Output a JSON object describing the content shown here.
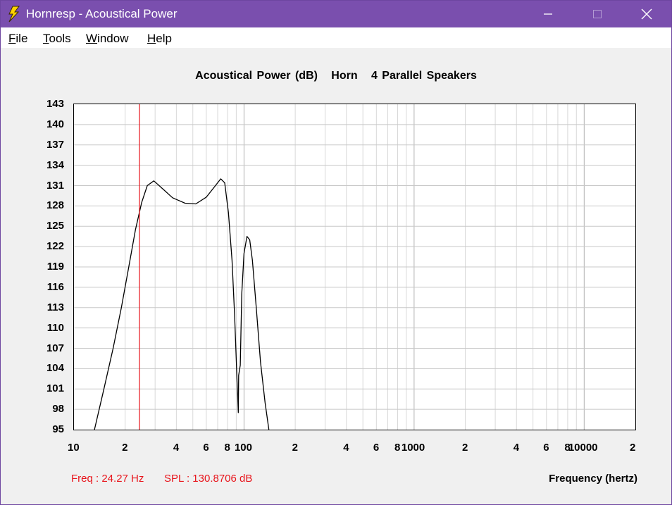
{
  "window": {
    "title": "Hornresp - Acoustical Power",
    "title_bar_color": "#7a4fae",
    "controls": [
      "minimize-icon",
      "maximize-icon",
      "close-icon"
    ]
  },
  "menu": {
    "file": {
      "label_first": "F",
      "label_rest": "ile"
    },
    "tools": {
      "label_first": "T",
      "label_rest": "ools"
    },
    "window": {
      "label_first": "W",
      "label_rest": "indow"
    },
    "help": {
      "label_first": "H",
      "label_rest": "elp"
    }
  },
  "status": {
    "freq": "Freq : 24.27 Hz",
    "spl": "SPL : 130.8706 dB",
    "color": "#e8141b"
  },
  "chart_data": {
    "type": "line",
    "title": "Acoustical Power (dB)   Horn   4 Parallel Speakers",
    "xlabel": "Frequency (hertz)",
    "ylabel": "",
    "x_scale": "log",
    "xlim": [
      10,
      20000
    ],
    "ylim": [
      95,
      143
    ],
    "yticks": [
      "143",
      "140",
      "137",
      "134",
      "131",
      "128",
      "125",
      "122",
      "119",
      "116",
      "113",
      "110",
      "107",
      "104",
      "101",
      "98",
      "95"
    ],
    "xtick_labels": [
      {
        "x": 10,
        "label": "10"
      },
      {
        "x": 20,
        "label": "2"
      },
      {
        "x": 40,
        "label": "4"
      },
      {
        "x": 60,
        "label": "6"
      },
      {
        "x": 80,
        "label": "8"
      },
      {
        "x": 100,
        "label": "100"
      },
      {
        "x": 200,
        "label": "2"
      },
      {
        "x": 400,
        "label": "4"
      },
      {
        "x": 600,
        "label": "6"
      },
      {
        "x": 800,
        "label": "8"
      },
      {
        "x": 1000,
        "label": "1000"
      },
      {
        "x": 2000,
        "label": "2"
      },
      {
        "x": 4000,
        "label": "4"
      },
      {
        "x": 6000,
        "label": "6"
      },
      {
        "x": 8000,
        "label": "8"
      },
      {
        "x": 10000,
        "label": "10000"
      },
      {
        "x": 20000,
        "label": "2"
      }
    ],
    "grid": true,
    "cursor": {
      "x": 24.27,
      "color": "#e8141b"
    },
    "series": [
      {
        "color": "#000000",
        "points": [
          [
            13.2,
            95
          ],
          [
            15,
            101
          ],
          [
            17,
            107
          ],
          [
            19,
            113
          ],
          [
            21,
            119
          ],
          [
            23,
            124.5
          ],
          [
            25,
            128.5
          ],
          [
            27,
            131
          ],
          [
            29.5,
            131.7
          ],
          [
            33,
            130.6
          ],
          [
            38,
            129.2
          ],
          [
            45,
            128.4
          ],
          [
            52,
            128.3
          ],
          [
            60,
            129.3
          ],
          [
            67,
            130.8
          ],
          [
            73,
            132.0
          ],
          [
            77,
            131.4
          ],
          [
            81,
            127.0
          ],
          [
            85,
            120.0
          ],
          [
            88,
            112.0
          ],
          [
            91,
            102.0
          ],
          [
            92.5,
            97.5
          ],
          [
            93,
            103.0
          ],
          [
            94.3,
            104.0
          ],
          [
            95,
            104.5
          ],
          [
            97,
            115.0
          ],
          [
            100,
            121.0
          ],
          [
            104,
            123.5
          ],
          [
            108,
            123.0
          ],
          [
            112,
            120.0
          ],
          [
            118,
            113.0
          ],
          [
            125,
            105.0
          ],
          [
            133,
            99.0
          ],
          [
            140,
            95.0
          ]
        ]
      }
    ]
  }
}
